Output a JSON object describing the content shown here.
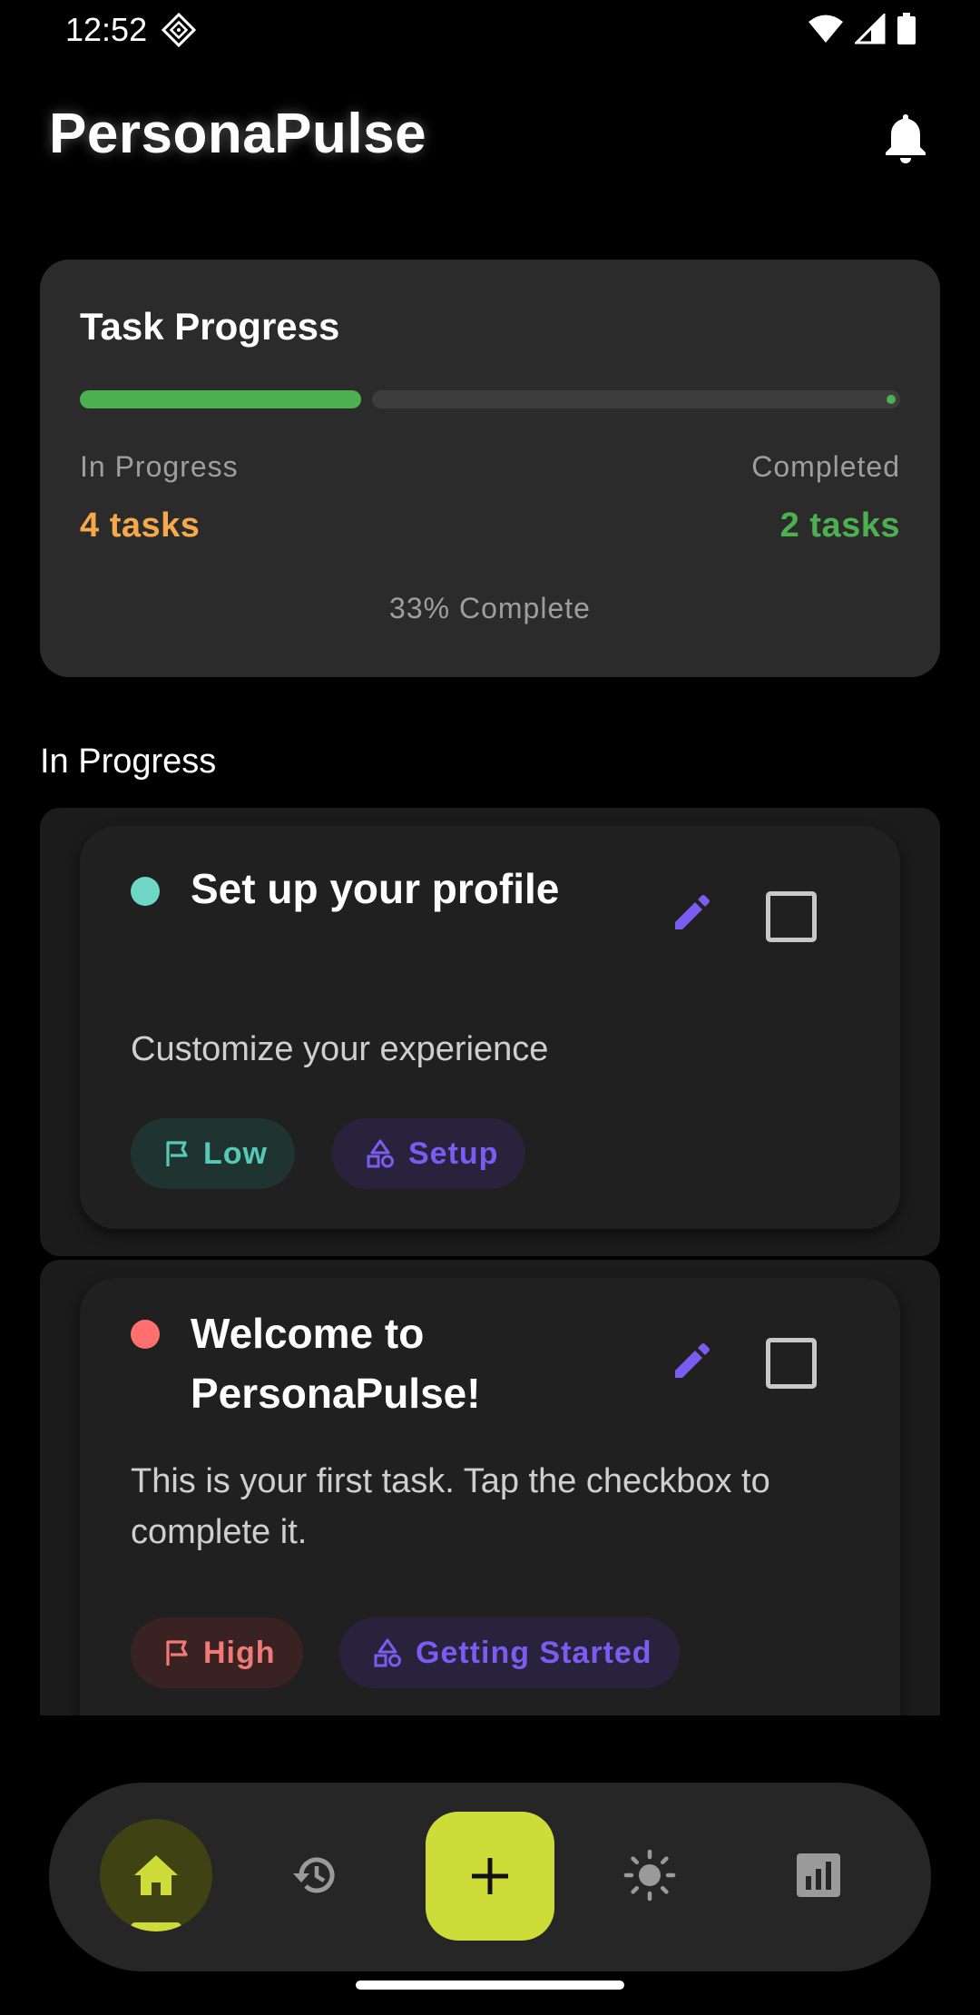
{
  "status_bar": {
    "time": "12:52"
  },
  "header": {
    "title": "PersonaPulse"
  },
  "progress_card": {
    "title": "Task Progress",
    "progress_fraction": 0.33,
    "in_progress_label": "In Progress",
    "in_progress_value": "4 tasks",
    "completed_label": "Completed",
    "completed_value": "2 tasks",
    "percent_text": "33% Complete"
  },
  "section": {
    "heading": "In Progress"
  },
  "tasks": [
    {
      "title": "Set up your profile",
      "description": "Customize your experience",
      "dot_color": "#6fd6c6",
      "priority": "Low",
      "category": "Setup"
    },
    {
      "title_line1": "Welcome to",
      "title_line2": "PersonaPulse!",
      "description_line1": "This is your first task. Tap the checkbox to",
      "description_line2": "complete it.",
      "dot_color": "#ff6f6f",
      "priority": "High",
      "category": "Getting Started"
    }
  ],
  "bottom_nav": {
    "items": [
      "home-icon",
      "history-icon",
      "add-icon",
      "brightness-icon",
      "stats-icon"
    ],
    "active": "home-icon"
  },
  "colors": {
    "accent": "#cddc39",
    "progress_green": "#4caf50",
    "in_progress_orange": "#f5a94a",
    "edit_purple": "#7b5cf0",
    "low_teal": "#55c9b5",
    "high_red": "#f07a7a"
  }
}
